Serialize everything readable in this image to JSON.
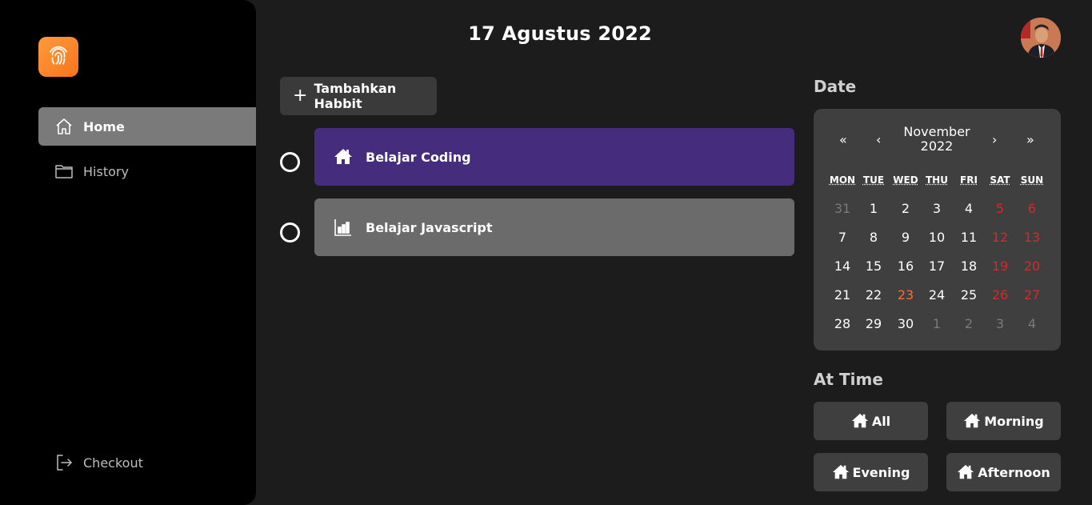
{
  "colors": {
    "accent": "#f7741c",
    "habit_primary": "#452c7c",
    "habit_secondary": "#6b6b6b",
    "weekend": "#d42a2a",
    "today": "#ff6a3a"
  },
  "sidebar": {
    "logo_icon": "fingerprint-icon",
    "items": [
      {
        "label": "Home",
        "icon": "home-icon",
        "active": true
      },
      {
        "label": "History",
        "icon": "folder-icon",
        "active": false
      }
    ],
    "checkout_label": "Checkout"
  },
  "header": {
    "title": "17 Agustus 2022"
  },
  "add_habit": {
    "label": "Tambahkan Habbit",
    "icon": "plus-icon"
  },
  "habits": [
    {
      "label": "Belajar Coding",
      "icon": "home-icon"
    },
    {
      "label": "Belajar Javascript",
      "icon": "bar-chart-icon"
    }
  ],
  "date_section": {
    "label": "Date"
  },
  "calendar": {
    "prev_year": "«",
    "prev_month": "‹",
    "next_month": "›",
    "next_year": "»",
    "month_label": "November 2022",
    "weekdays": [
      "MON",
      "TUE",
      "WED",
      "THU",
      "FRI",
      "SAT",
      "SUN"
    ],
    "weeks": [
      [
        "31",
        "1",
        "2",
        "3",
        "4",
        "5",
        "6"
      ],
      [
        "7",
        "8",
        "9",
        "10",
        "11",
        "12",
        "13"
      ],
      [
        "14",
        "15",
        "16",
        "17",
        "18",
        "19",
        "20"
      ],
      [
        "21",
        "22",
        "23",
        "24",
        "25",
        "26",
        "27"
      ],
      [
        "28",
        "29",
        "30",
        "1",
        "2",
        "3",
        "4"
      ]
    ],
    "today": "23"
  },
  "time_section": {
    "label": "At Time",
    "buttons": [
      "All",
      "Morning",
      "Evening",
      "Afternoon"
    ]
  }
}
